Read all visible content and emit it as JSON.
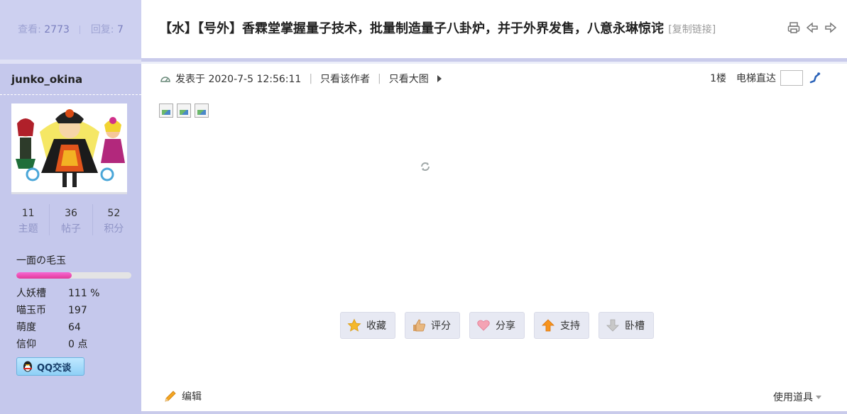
{
  "thread": {
    "views_label": "查看:",
    "views": "2773",
    "replies_label": "回复:",
    "replies": "7",
    "title": "【水】【号外】香霖堂掌握量子技术，批量制造量子八卦炉，并于外界发售，八意永琳惊诧",
    "copy_link": "[复制链接]"
  },
  "author": {
    "name": "junko_okina",
    "stats": [
      {
        "value": "11",
        "label": "主题"
      },
      {
        "value": "36",
        "label": "帖子"
      },
      {
        "value": "52",
        "label": "积分"
      }
    ],
    "rank": "一面の毛玉",
    "rank_progress": 0.48,
    "props": [
      {
        "key": "人妖槽",
        "value": "111 %"
      },
      {
        "key": "喵玉币",
        "value": "197"
      },
      {
        "key": "萌度",
        "value": "64"
      },
      {
        "key": "信仰",
        "value": "0 点"
      }
    ],
    "qq_button": "QQ交谈"
  },
  "post": {
    "posted_at": "发表于 2020-7-5 12:56:11",
    "only_author": "只看该作者",
    "only_images": "只看大图",
    "floor": "1楼",
    "jump_label": "电梯直达",
    "jump_value": ""
  },
  "actions": [
    {
      "label": "收藏",
      "icon": "star-icon"
    },
    {
      "label": "评分",
      "icon": "thumbs-up-icon"
    },
    {
      "label": "分享",
      "icon": "heart-icon"
    },
    {
      "label": "支持",
      "icon": "arrow-up-icon"
    },
    {
      "label": "卧槽",
      "icon": "arrow-down-icon"
    }
  ],
  "footer": {
    "edit": "编辑",
    "tools": "使用道具"
  },
  "colors": {
    "sidebar": "#c5c8ec",
    "accent_bar": "#c9cbeb",
    "progress": "#e33a99"
  }
}
